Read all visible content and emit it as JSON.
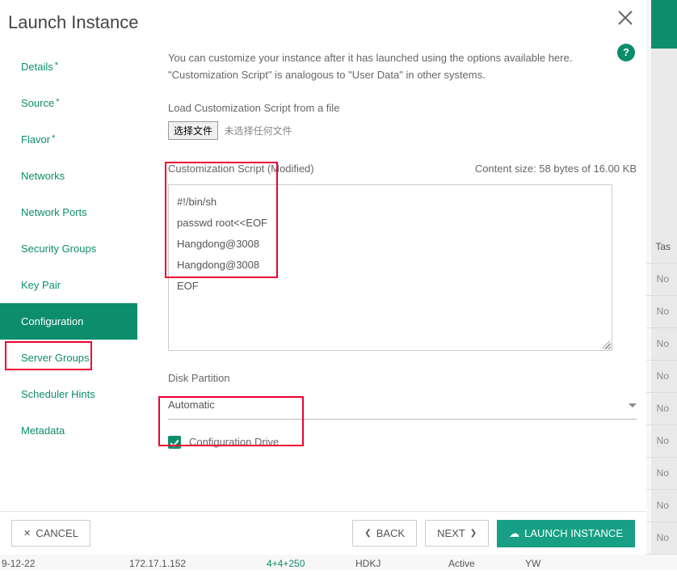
{
  "header": {
    "title": "Launch Instance"
  },
  "sidebar": {
    "items": [
      {
        "label": "Details",
        "required": true,
        "active": false
      },
      {
        "label": "Source",
        "required": true,
        "active": false
      },
      {
        "label": "Flavor",
        "required": true,
        "active": false
      },
      {
        "label": "Networks",
        "required": false,
        "active": false
      },
      {
        "label": "Network Ports",
        "required": false,
        "active": false
      },
      {
        "label": "Security Groups",
        "required": false,
        "active": false
      },
      {
        "label": "Key Pair",
        "required": false,
        "active": false
      },
      {
        "label": "Configuration",
        "required": false,
        "active": true
      },
      {
        "label": "Server Groups",
        "required": false,
        "active": false
      },
      {
        "label": "Scheduler Hints",
        "required": false,
        "active": false
      },
      {
        "label": "Metadata",
        "required": false,
        "active": false
      }
    ]
  },
  "config": {
    "intro_line1": "You can customize your instance after it has launched using the options available here.",
    "intro_line2": "\"Customization Script\" is analogous to \"User Data\" in other systems.",
    "load_label": "Load Customization Script from a file",
    "file_button": "选择文件",
    "file_status": "未选择任何文件",
    "script_label": "Customization Script (Modified)",
    "content_size": "Content size: 58 bytes of 16.00 KB",
    "script_value": "#!/bin/sh\npasswd root<<EOF\nHangdong@3008\nHangdong@3008\nEOF",
    "disk_partition_label": "Disk Partition",
    "disk_partition_value": "Automatic",
    "config_drive_label": "Configuration Drive",
    "config_drive_checked": true
  },
  "footer": {
    "cancel": "CANCEL",
    "back": "BACK",
    "next": "NEXT",
    "launch": "LAUNCH INSTANCE"
  },
  "background_row": {
    "col0": "9-12-22",
    "col1": "172.17.1.152",
    "col2": "4+4+250",
    "col3": "HDKJ",
    "col4": "Active",
    "col5": "YW",
    "task_header": "Tas",
    "cell_text": "No"
  }
}
